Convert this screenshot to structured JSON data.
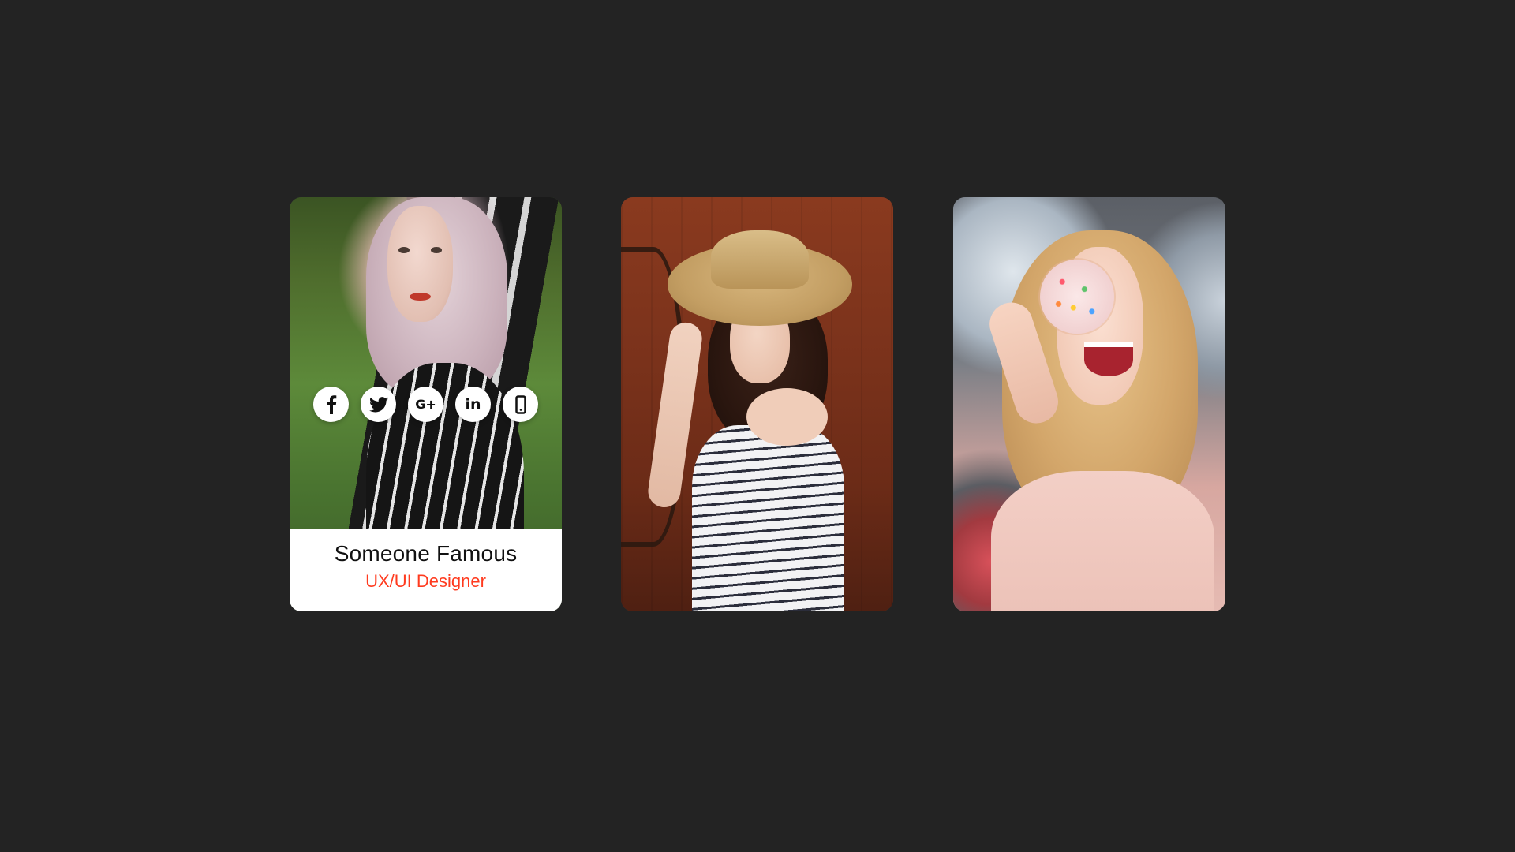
{
  "colors": {
    "background": "#232323",
    "card_footer": "#ffffff",
    "name_text": "#111111",
    "accent": "#ff3b1f"
  },
  "cards": [
    {
      "photo": "woman-in-grass-striped-shirt",
      "name": "Someone Famous",
      "role": "UX/UI Designer",
      "social_icons": [
        "facebook-icon",
        "twitter-icon",
        "google-plus-icon",
        "linkedin-icon",
        "phone-icon"
      ],
      "google_plus_glyph": "G+",
      "linkedin_glyph": "in"
    },
    {
      "photo": "woman-with-straw-hat"
    },
    {
      "photo": "woman-with-donut"
    }
  ]
}
